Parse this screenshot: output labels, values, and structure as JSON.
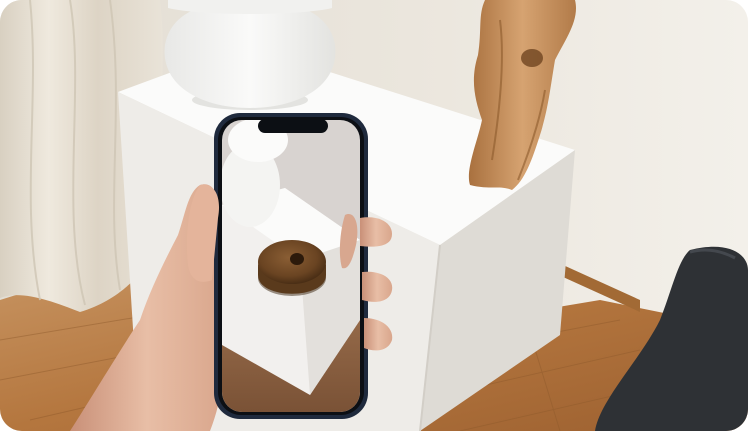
{
  "image": {
    "alt": "",
    "colors": {
      "wall": "#ece7de",
      "curtain": "#e7e0d3",
      "floor": "#b47a44",
      "cabinet_top": "#ffffff",
      "cabinet_side": "#e9e7e3",
      "lamp": "#f7f7f6",
      "wood_figure": "#c68f5a",
      "phone_frame": "#1f2a3d",
      "phone_screen_bg": "#d7d2d0",
      "ar_stump": "#6a4522",
      "skin": "#e2b59b",
      "sofa": "#2e3135"
    },
    "elements": [
      "lamp",
      "white-cabinet",
      "wooden-figure",
      "curtain",
      "wood-floor",
      "dark-sofa",
      "smartphone",
      "hand"
    ]
  }
}
